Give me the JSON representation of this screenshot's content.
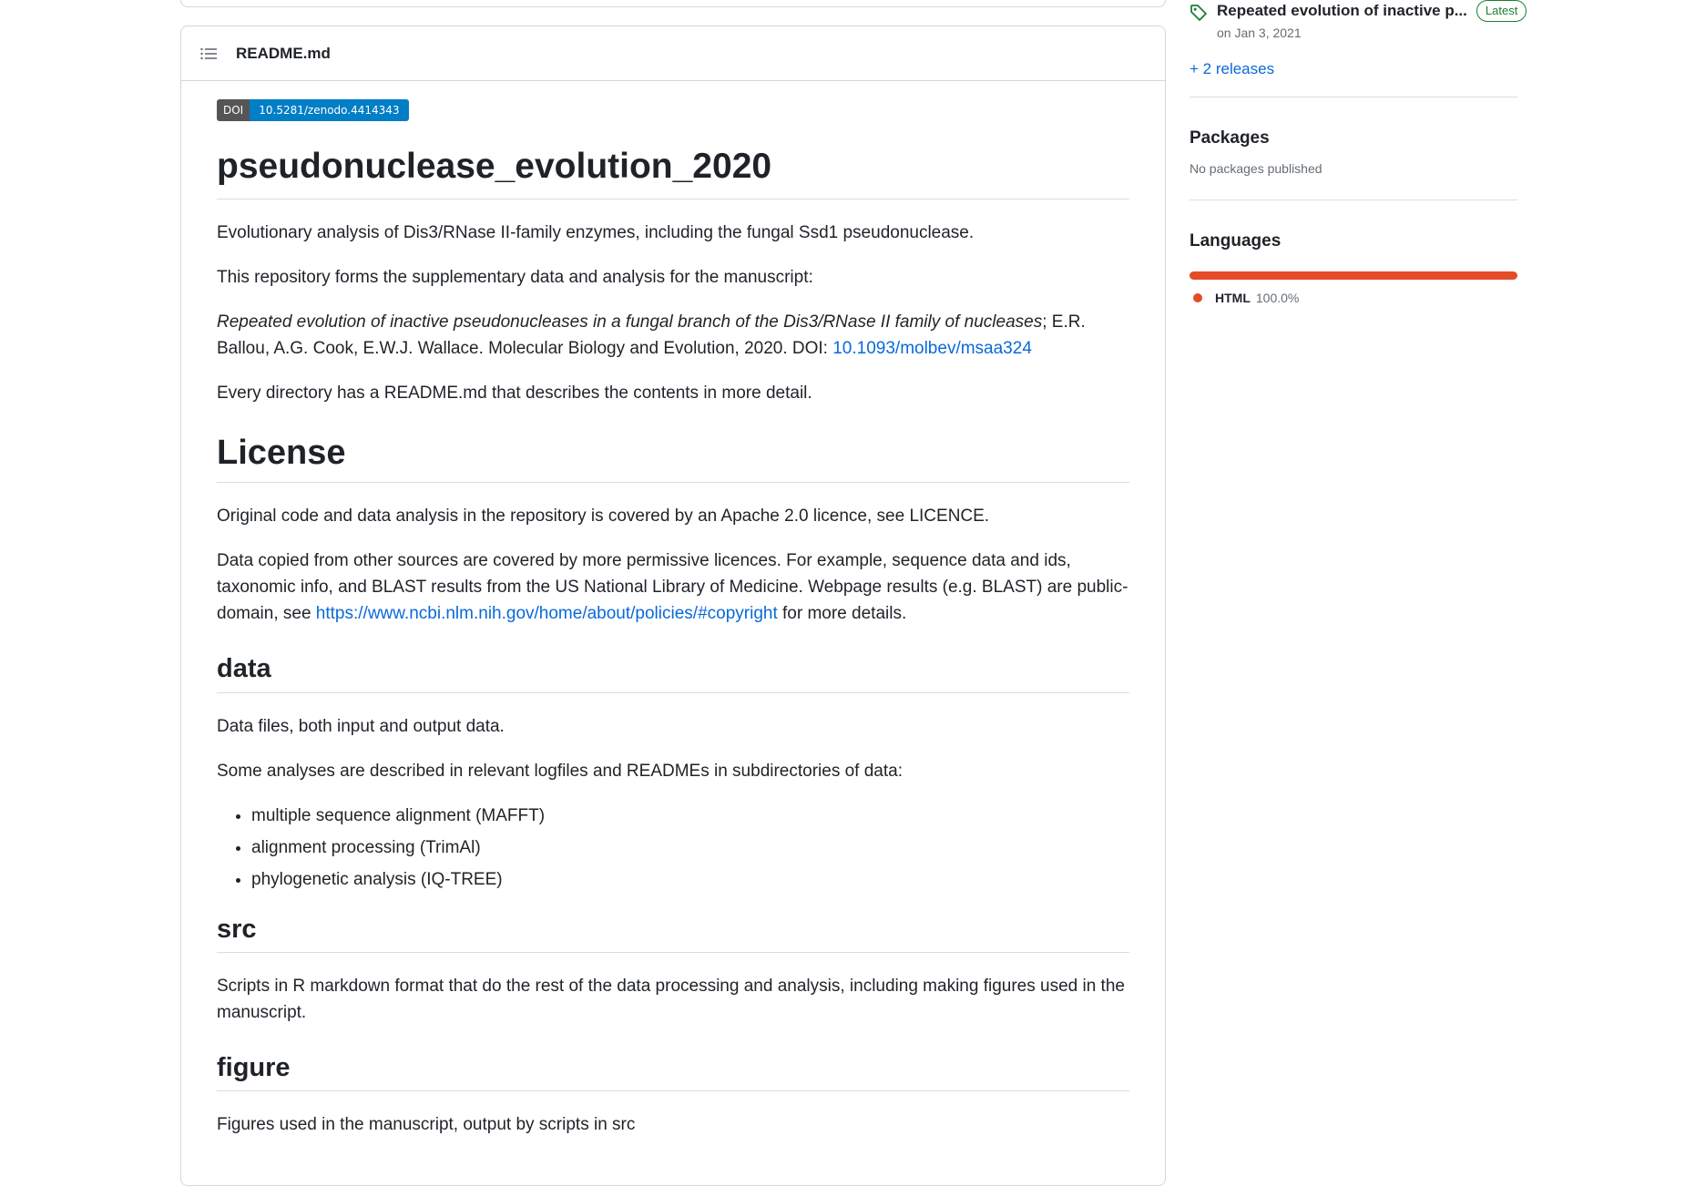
{
  "readme": {
    "filename": "README.md",
    "doi_badge": {
      "label": "DOI",
      "value": "10.5281/zenodo.4414343",
      "label_color": "#555555",
      "value_color": "#007ec6"
    },
    "title": "pseudonuclease_evolution_2020",
    "intro_paragraph": "Evolutionary analysis of Dis3/RNase II-family enzymes, including the fungal Ssd1 pseudonuclease.",
    "supplementary_paragraph": "This repository forms the supplementary data and analysis for the manuscript:",
    "citation": {
      "title_italic": "Repeated evolution of inactive pseudonucleases in a fungal branch of the Dis3/RNase II family of nucleases",
      "rest": "; E.R. Ballou, A.G. Cook, E.W.J. Wallace. Molecular Biology and Evolution, 2020. DOI: ",
      "doi_link": "10.1093/molbev/msaa324"
    },
    "directory_paragraph": "Every directory has a README.md that describes the contents in more detail.",
    "license": {
      "heading": "License",
      "paragraph1": "Original code and data analysis in the repository is covered by an Apache 2.0 licence, see LICENCE.",
      "paragraph2_before": "Data copied from other sources are covered by more permissive licences. For example, sequence data and ids, taxonomic info, and BLAST results from the US National Library of Medicine. Webpage results (e.g. BLAST) are public-domain, see ",
      "paragraph2_link": "https://www.ncbi.nlm.nih.gov/home/about/policies/#copyright",
      "paragraph2_after": " for more details."
    },
    "data_section": {
      "heading": "data",
      "paragraph1": "Data files, both input and output data.",
      "paragraph2": "Some analyses are described in relevant logfiles and READMEs in subdirectories of data:",
      "items": [
        "multiple sequence alignment (MAFFT)",
        "alignment processing (TrimAl)",
        "phylogenetic analysis (IQ-TREE)"
      ]
    },
    "src_section": {
      "heading": "src",
      "paragraph": "Scripts in R markdown format that do the rest of the data processing and analysis, including making figures used in the manuscript."
    },
    "figure_section": {
      "heading": "figure",
      "paragraph": "Figures used in the manuscript, output by scripts in src"
    }
  },
  "sidebar": {
    "release": {
      "title": "Repeated evolution of inactive p...",
      "badge": "Latest",
      "date": "on Jan 3, 2021",
      "icon": "tag-icon"
    },
    "more_releases": "+ 2 releases",
    "packages": {
      "heading": "Packages",
      "text": "No packages published"
    },
    "languages": {
      "heading": "Languages",
      "items": [
        {
          "name": "HTML",
          "percent": "100.0%",
          "color": "#e34c26"
        }
      ]
    }
  }
}
